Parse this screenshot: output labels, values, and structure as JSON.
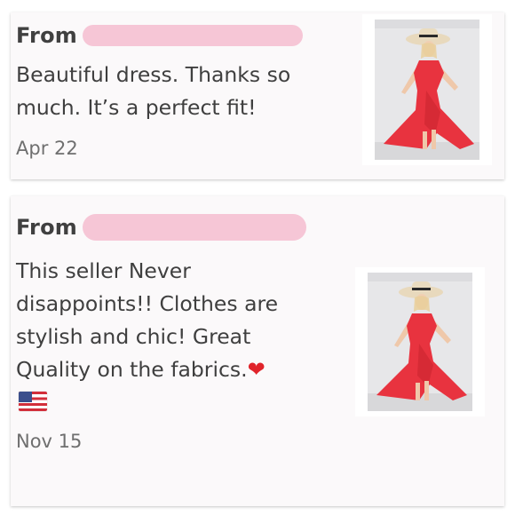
{
  "reviews": [
    {
      "from_label": "From",
      "message": "Beautiful dress. Thanks so much. It’s a perfect fit!",
      "date": "Apr 22",
      "photo_icon": "red-dress-photo"
    },
    {
      "from_label": "From",
      "message": "This seller Never disappoints!! Clothes are stylish and chic! Great Quality on the fabrics.",
      "emoji_heart": "❤",
      "emoji_flag": "us-flag-icon",
      "date": "Nov 15",
      "photo_icon": "red-dress-photo"
    }
  ],
  "colors": {
    "redaction": "#f6c6d6",
    "dress_red": "#e8333f",
    "card_bg": "#fbf9fa"
  }
}
